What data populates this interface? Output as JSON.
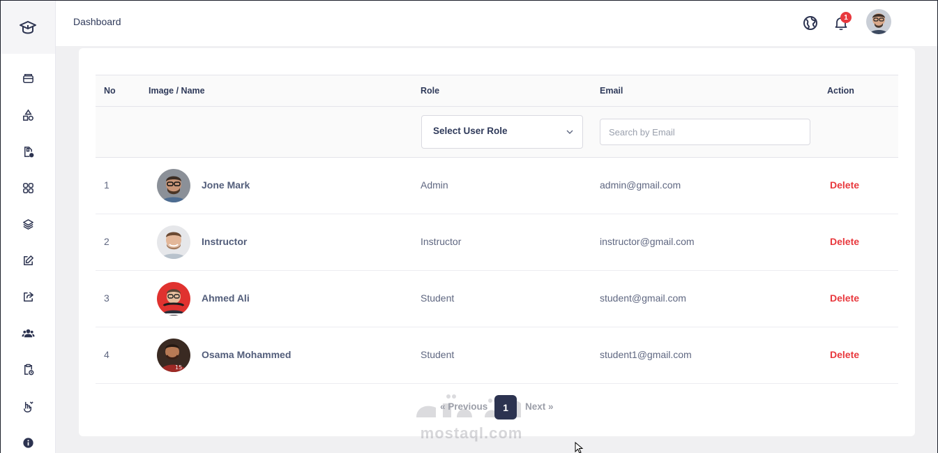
{
  "header": {
    "title": "Dashboard",
    "notification_count": "1"
  },
  "sidebar": {
    "icons": [
      "graduation-cap-icon",
      "archive-box-icon",
      "shapes-icon",
      "file-settings-icon",
      "grid-icon",
      "layers-icon",
      "edit-icon",
      "share-icon",
      "users-icon",
      "clipboard-clock-icon",
      "hand-coin-icon",
      "info-icon"
    ]
  },
  "table": {
    "headers": {
      "no": "No",
      "name": "Image / Name",
      "role": "Role",
      "email": "Email",
      "action": "Action"
    },
    "filters": {
      "role_select": "Select User Role",
      "email_placeholder": "Search by Email"
    },
    "rows": [
      {
        "no": "1",
        "name": "Jone Mark",
        "role": "Admin",
        "email": "admin@gmail.com",
        "action": "Delete"
      },
      {
        "no": "2",
        "name": "Instructor",
        "role": "Instructor",
        "email": "instructor@gmail.com",
        "action": "Delete"
      },
      {
        "no": "3",
        "name": "Ahmed Ali",
        "role": "Student",
        "email": "student@gmail.com",
        "action": "Delete"
      },
      {
        "no": "4",
        "name": "Osama Mohammed",
        "role": "Student",
        "email": "student1@gmail.com",
        "action": "Delete"
      }
    ]
  },
  "pagination": {
    "previous": "« Previous",
    "current": "1",
    "next": "Next »"
  },
  "watermark": {
    "text": "mostaql.com"
  },
  "colors": {
    "accent": "#2c3350",
    "danger": "#e8383d"
  }
}
